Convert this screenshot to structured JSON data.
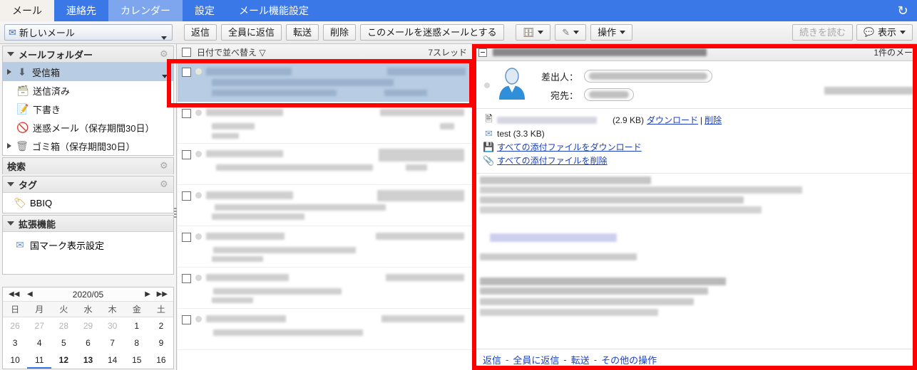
{
  "tabs": [
    {
      "label": "メール",
      "state": "active"
    },
    {
      "label": "連絡先",
      "state": "normal"
    },
    {
      "label": "カレンダー",
      "state": "soft"
    },
    {
      "label": "設定",
      "state": "normal"
    },
    {
      "label": "メール機能設定",
      "state": "normal"
    }
  ],
  "titlebar": {
    "refresh_icon": "refresh-icon"
  },
  "toolbar": {
    "new_mail_label": "新しいメール",
    "new_mail_icon": "new-mail-icon",
    "buttons": [
      {
        "label": "返信",
        "name": "reply-button"
      },
      {
        "label": "全員に返信",
        "name": "reply-all-button"
      },
      {
        "label": "転送",
        "name": "forward-button"
      },
      {
        "label": "削除",
        "name": "delete-button"
      },
      {
        "label": "このメールを迷惑メールとする",
        "name": "mark-spam-button"
      }
    ],
    "move_icon": "move-to-folder-icon",
    "tag_icon": "tag-icon",
    "action_label": "操作",
    "continue_label": "続きを読む",
    "view_label": "表示",
    "view_icon": "speech-bubble-icon"
  },
  "sidebar": {
    "mail_folder_header": "メールフォルダー",
    "folders": [
      {
        "label": "受信箱",
        "icon": "inbox-icon",
        "selected": true,
        "expandable": true
      },
      {
        "label": "送信済み",
        "icon": "sent-icon",
        "selected": false,
        "expandable": false
      },
      {
        "label": "下書き",
        "icon": "draft-icon",
        "selected": false,
        "expandable": false
      },
      {
        "label": "迷惑メール（保存期間30日）",
        "icon": "spam-icon",
        "selected": false,
        "expandable": false
      },
      {
        "label": "ゴミ箱（保存期間30日）",
        "icon": "trash-icon",
        "selected": false,
        "expandable": true
      }
    ],
    "search_header": "検索",
    "tag_header": "タグ",
    "tags": [
      {
        "label": "BBIQ",
        "icon": "tag-icon"
      }
    ],
    "extension_header": "拡張機能",
    "extensions": [
      {
        "label": "国マーク表示設定",
        "icon": "envelope-icon"
      }
    ]
  },
  "calendar": {
    "title": "2020/05",
    "nav": {
      "first": "◀◀",
      "prev": "◀",
      "next": "▶",
      "last": "▶▶"
    },
    "dow": [
      "日",
      "月",
      "火",
      "水",
      "木",
      "金",
      "土"
    ],
    "weeks": [
      [
        {
          "d": "26",
          "dim": true
        },
        {
          "d": "27",
          "dim": true
        },
        {
          "d": "28",
          "dim": true
        },
        {
          "d": "29",
          "dim": true
        },
        {
          "d": "30",
          "dim": true
        },
        {
          "d": "1"
        },
        {
          "d": "2"
        }
      ],
      [
        {
          "d": "3"
        },
        {
          "d": "4"
        },
        {
          "d": "5"
        },
        {
          "d": "6"
        },
        {
          "d": "7"
        },
        {
          "d": "8"
        },
        {
          "d": "9"
        }
      ],
      [
        {
          "d": "10"
        },
        {
          "d": "11",
          "today": true
        },
        {
          "d": "12",
          "bold": true
        },
        {
          "d": "13",
          "bold": true
        },
        {
          "d": "14"
        },
        {
          "d": "15"
        },
        {
          "d": "16"
        }
      ]
    ]
  },
  "message_list": {
    "sort_label": "日付で並べ替え",
    "sort_caret": "▽",
    "thread_count": "7スレッド",
    "rows": [
      {
        "selected": true
      },
      {
        "selected": false
      },
      {
        "selected": false
      },
      {
        "selected": false
      },
      {
        "selected": false
      },
      {
        "selected": false
      },
      {
        "selected": false
      }
    ]
  },
  "reading_pane": {
    "mail_count": "1件のメー",
    "from_label": "差出人：",
    "to_label": "宛先：",
    "attachments": {
      "file1_size": "(2.9 KB)",
      "download_label": "ダウンロード",
      "divider": "|",
      "delete_label": "削除",
      "file2_name": "test (3.3 KB)",
      "download_all_label": "すべての添付ファイルをダウンロード",
      "delete_all_label": "すべての添付ファイルを削除"
    },
    "footer": {
      "reply": "返信",
      "reply_all": "全員に返信",
      "forward": "転送",
      "more": "その他の操作",
      "sep": "-"
    }
  },
  "colors": {
    "tab_bar": "#3b78e7",
    "selection": "#b8cce4",
    "highlight_box": "#ff0000",
    "link": "#1a3fbf"
  }
}
